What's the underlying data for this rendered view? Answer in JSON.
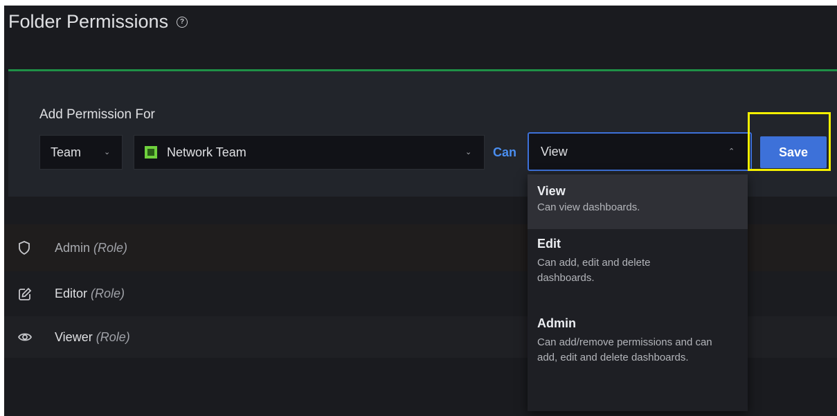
{
  "page": {
    "title": "Folder Permissions",
    "help_icon": "question-circle-icon"
  },
  "add_permission": {
    "label": "Add Permission For",
    "type_select": {
      "value": "Team",
      "icon": "chevron-down-icon"
    },
    "team_select": {
      "value": "Network Team",
      "avatar_icon": "team-avatar-icon",
      "icon": "chevron-down-icon"
    },
    "can_label": "Can",
    "permission_select": {
      "value": "View",
      "icon": "chevron-up-icon",
      "open": true
    },
    "save_label": "Save"
  },
  "permission_options": [
    {
      "title": "View",
      "description": "Can view dashboards.",
      "selected": true
    },
    {
      "title": "Edit",
      "description": "Can add, edit and delete dashboards.",
      "selected": false
    },
    {
      "title": "Admin",
      "description": "Can add/remove permissions and can add, edit and delete dashboards.",
      "selected": false
    }
  ],
  "permission_rows": [
    {
      "name": "Admin",
      "role": "(Role)",
      "icon": "shield-icon"
    },
    {
      "name": "Editor",
      "role": "(Role)",
      "icon": "edit-icon"
    },
    {
      "name": "Viewer",
      "role": "(Role)",
      "icon": "eye-icon"
    }
  ],
  "colors": {
    "accent": "#3d71d9",
    "highlight": "#f5f000",
    "separator": "#1f9147",
    "background": "#1a1b1f"
  }
}
